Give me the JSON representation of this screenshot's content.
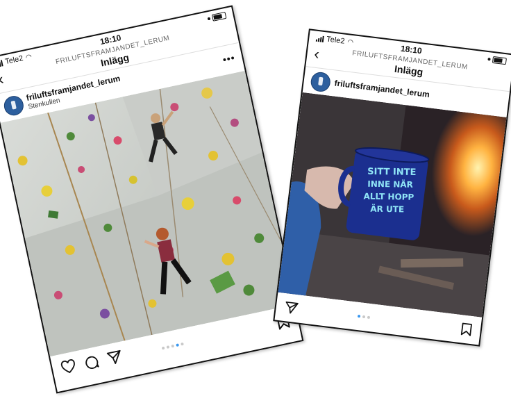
{
  "left_phone": {
    "status": {
      "carrier": "Tele2",
      "time": "18:10"
    },
    "header": {
      "account": "FRILUFTSFRAMJANDET_LERUM",
      "page_title": "Inlägg"
    },
    "post": {
      "username": "friluftsframjandet_lerum",
      "location": "Stenkullen",
      "image": "indoor climbing wall with two climbers",
      "carousel": {
        "count": 5,
        "active_index": 3
      }
    },
    "icons": {
      "back": "back-chevron-icon",
      "more": "more-icon",
      "like": "heart-icon",
      "comment": "comment-icon",
      "share": "send-icon",
      "save": "bookmark-icon"
    }
  },
  "right_phone": {
    "status": {
      "carrier": "Tele2",
      "time": "18:10"
    },
    "header": {
      "account": "FRILUFTSFRAMJANDET_LERUM",
      "page_title": "Inlägg"
    },
    "post": {
      "username": "friluftsframjandet_lerum",
      "image": "hand holding blue enamel mug in front of a fire",
      "mug_text": [
        "SITT INTE",
        "INNE NÄR",
        "ALLT HOPP",
        "ÄR UTE"
      ],
      "carousel": {
        "count": 3,
        "active_index": 0
      }
    },
    "icons": {
      "back": "back-chevron-icon",
      "more": "more-icon",
      "share": "send-icon",
      "save": "bookmark-icon"
    }
  },
  "colors": {
    "accent": "#3897f0",
    "avatar": "#2d5f9e",
    "mug": "#1b2f8f"
  }
}
